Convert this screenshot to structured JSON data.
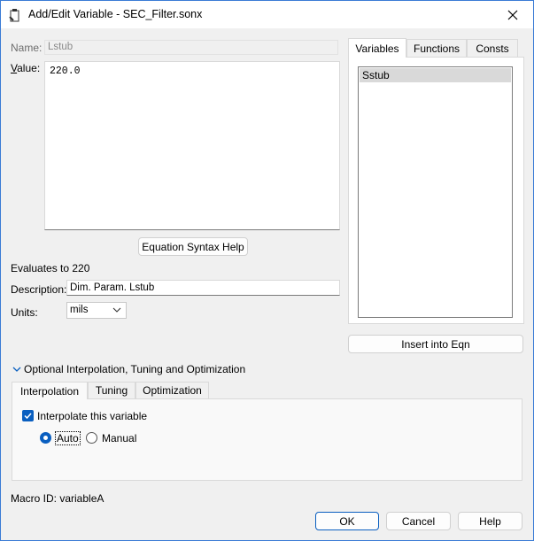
{
  "window": {
    "title": "Add/Edit Variable - SEC_Filter.sonx",
    "close_icon": "close-icon"
  },
  "form": {
    "name_label": "Name:",
    "name_value": "Lstub",
    "value_label": "Value:",
    "value_text": "220.0",
    "syntax_help_button": "Equation Syntax Help",
    "evaluates_text": "Evaluates to 220",
    "description_label": "Description:",
    "description_value": "Dim. Param. Lstub",
    "units_label": "Units:",
    "units_value": "mils"
  },
  "right_tabs": {
    "tabs": [
      "Variables",
      "Functions",
      "Consts"
    ],
    "active": "Variables",
    "variables": [
      "Sstub"
    ],
    "insert_button": "Insert into Eqn"
  },
  "optional_section": {
    "header": "Optional Interpolation, Tuning and Optimization",
    "tabs": [
      "Interpolation",
      "Tuning",
      "Optimization"
    ],
    "active": "Interpolation",
    "interpolate_label": "Interpolate this variable",
    "interpolate_checked": true,
    "mode_options": [
      "Auto",
      "Manual"
    ],
    "mode_selected": "Auto"
  },
  "footer": {
    "macro_id": "Macro ID: variableA",
    "ok_button": "OK",
    "cancel_button": "Cancel",
    "help_button": "Help"
  },
  "colors": {
    "accent": "#0a5fc0",
    "window_bg": "#f0f0f0",
    "border_blue": "#3a7bd5"
  }
}
